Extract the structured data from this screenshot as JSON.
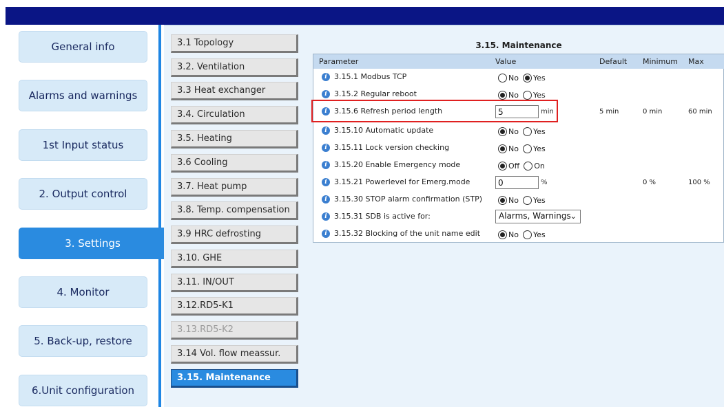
{
  "sidebar": {
    "items": [
      {
        "label": "General info"
      },
      {
        "label": "Alarms and warnings"
      },
      {
        "label": "1st Input status"
      },
      {
        "label": "2. Output control"
      },
      {
        "label": "3. Settings"
      },
      {
        "label": "4. Monitor"
      },
      {
        "label": "5. Back-up, restore"
      },
      {
        "label": "6.Unit configuration"
      }
    ]
  },
  "subnav": {
    "items": [
      {
        "label": "3.1 Topology"
      },
      {
        "label": "3.2. Ventilation"
      },
      {
        "label": "3.3 Heat exchanger"
      },
      {
        "label": "3.4. Circulation"
      },
      {
        "label": "3.5. Heating"
      },
      {
        "label": "3.6 Cooling"
      },
      {
        "label": "3.7. Heat pump"
      },
      {
        "label": "3.8. Temp. compensation"
      },
      {
        "label": "3.9 HRC defrosting"
      },
      {
        "label": "3.10. GHE"
      },
      {
        "label": "3.11. IN/OUT"
      },
      {
        "label": "3.12.RD5-K1"
      },
      {
        "label": "3.13.RD5-K2"
      },
      {
        "label": "3.14 Vol. flow meassur."
      },
      {
        "label": "3.15. Maintenance"
      }
    ]
  },
  "panel": {
    "title": "3.15. Maintenance",
    "headers": {
      "parameter": "Parameter",
      "value": "Value",
      "default": "Default",
      "minimum": "Minimum",
      "max": "Max"
    },
    "info_glyph": "i",
    "rows": [
      {
        "name": "3.15.1 Modbus TCP",
        "opt1": "No",
        "opt2": "Yes"
      },
      {
        "name": "3.15.2 Regular reboot",
        "opt1": "No",
        "opt2": "Yes"
      },
      {
        "name": "3.15.6 Refresh period length",
        "value": "5",
        "unit": "min",
        "default": "5 min",
        "minimum": "0 min",
        "max": "60 min"
      },
      {
        "name": "3.15.10 Automatic update",
        "opt1": "No",
        "opt2": "Yes"
      },
      {
        "name": "3.15.11 Lock version checking",
        "opt1": "No",
        "opt2": "Yes"
      },
      {
        "name": "3.15.20 Enable Emergency mode",
        "opt1": "Off",
        "opt2": "On"
      },
      {
        "name": "3.15.21 Powerlevel for Emerg.mode",
        "value": "0",
        "unit": "%",
        "minimum": "0 %",
        "max": "100 %"
      },
      {
        "name": "3.15.30 STOP alarm confirmation (STP)",
        "opt1": "No",
        "opt2": "Yes"
      },
      {
        "name": "3.15.31 SDB is active for:",
        "select": "Alarms, Warnings"
      },
      {
        "name": "3.15.32 Blocking of the unit name edit",
        "opt1": "No",
        "opt2": "Yes"
      }
    ]
  },
  "colors": {
    "topbar": "#0a1585",
    "accent": "#2a8be0",
    "highlight": "#e02020"
  }
}
